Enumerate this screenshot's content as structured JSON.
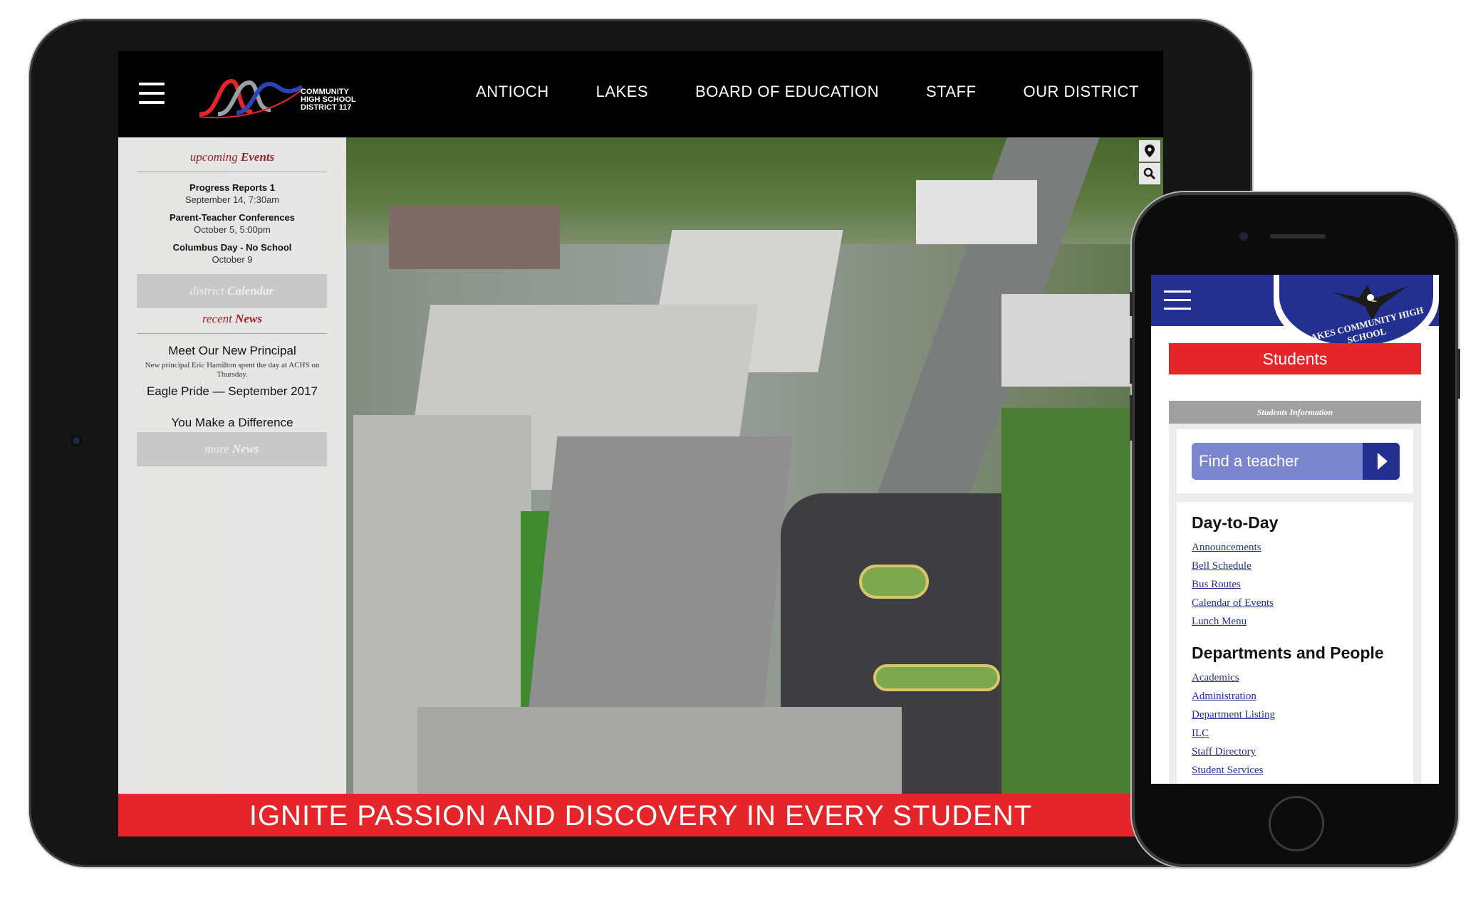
{
  "tablet": {
    "logo": {
      "line1": "COMMUNITY",
      "line2": "HIGH SCHOOL",
      "line3": "DISTRICT 117"
    },
    "nav": [
      {
        "label": "ANTIOCH"
      },
      {
        "label": "LAKES"
      },
      {
        "label": "BOARD OF EDUCATION"
      },
      {
        "label": "STAFF"
      },
      {
        "label": "OUR DISTRICT"
      }
    ],
    "sidebar": {
      "events_heading": {
        "pre": "upcoming",
        "post": "Events"
      },
      "events": [
        {
          "title": "Progress Reports 1",
          "date": "September 14, 7:30am"
        },
        {
          "title": "Parent-Teacher Conferences",
          "date": "October 5, 5:00pm"
        },
        {
          "title": "Columbus Day - No School",
          "date": "October 9"
        }
      ],
      "calendar_button": {
        "pre": "district",
        "post": "Calendar"
      },
      "news_heading": {
        "pre": "recent",
        "post": "News"
      },
      "news": [
        {
          "title": "Meet Our New Principal",
          "summary": "New principal Eric Hamilton spent the day at ACHS on Thursday."
        },
        {
          "title": "Eagle Pride — September 2017",
          "summary": ""
        },
        {
          "title": "You Make a Difference",
          "summary": ""
        }
      ],
      "more_button": {
        "pre": "more",
        "post": "News"
      }
    },
    "banner": "IGNITE PASSION AND DISCOVERY IN EVERY STUDENT",
    "hero_tools": [
      {
        "icon": "map-pin-icon"
      },
      {
        "icon": "search-icon"
      }
    ]
  },
  "phone": {
    "logo_text": "LAKES COMMUNITY HIGH SCHOOL",
    "students_label": "Students",
    "info_label": "Students Information",
    "find_teacher": "Find a teacher",
    "sections": [
      {
        "title": "Day-to-Day",
        "links": [
          "Announcements",
          "Bell Schedule",
          "Bus Routes",
          "Calendar of Events",
          "Lunch Menu"
        ]
      },
      {
        "title": "Departments and People",
        "links": [
          "Academics",
          "Administration",
          "Department Listing",
          "ILC",
          "Staff Directory",
          "Student Services"
        ]
      }
    ]
  },
  "colors": {
    "brand_red": "#e4262b",
    "brand_blue": "#23308f",
    "sidebar_red": "#9c1f24"
  }
}
